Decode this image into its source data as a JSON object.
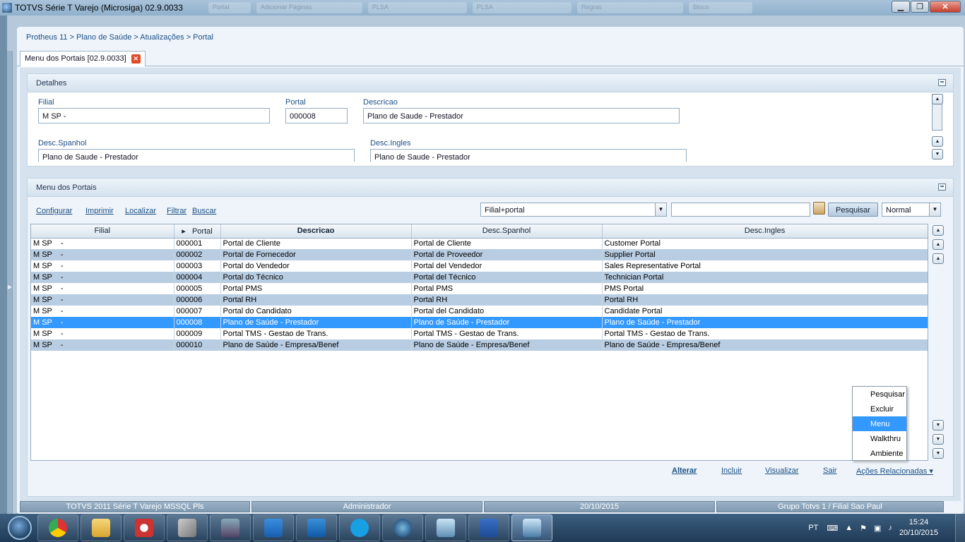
{
  "window": {
    "title": "TOTVS Série T Varejo (Microsiga) 02.9.0033",
    "ghost_tabs": [
      "Portal",
      "Adicionar Páginas",
      "PLSA",
      "PLSA",
      "Regras",
      "Bloco"
    ],
    "controls": {
      "minimize": "▁",
      "maximize": "❐",
      "close": "✕"
    }
  },
  "breadcrumb": "Protheus 11 > Plano de Saúde > Atualizações > Portal",
  "tab": {
    "label": "Menu dos Portais [02.9.0033]",
    "close": "✕"
  },
  "details": {
    "title": "Detalhes",
    "fields": {
      "filial": {
        "label": "Filial",
        "value": "M SP    -"
      },
      "portal": {
        "label": "Portal",
        "value": "000008"
      },
      "descricao": {
        "label": "Descricao",
        "value": "Plano de Saude - Prestador"
      },
      "desc_spanhol": {
        "label": "Desc.Spanhol",
        "value": "Plano de Saude - Prestador"
      },
      "desc_ingles": {
        "label": "Desc.Ingles",
        "value": "Plano de Saude - Prestador"
      }
    }
  },
  "menu_panel": {
    "title": "Menu dos Portais",
    "toolbar_links": [
      "Configurar",
      "Imprimir",
      "Localizar",
      "Filtrar",
      "Buscar"
    ],
    "index_combo": "Filial+portal",
    "search_value": "",
    "search_button": "Pesquisar",
    "mode_combo": "Normal"
  },
  "grid": {
    "columns": [
      "Filial",
      "Portal",
      "Descricao",
      "Desc.Spanhol",
      "Desc.Ingles"
    ],
    "sort_indicator": "▸",
    "rows": [
      [
        "M SP    -",
        "000001",
        "Portal de Cliente",
        "Portal de Cliente",
        "Customer Portal"
      ],
      [
        "M SP    -",
        "000002",
        "Portal de Fornecedor",
        "Portal de Proveedor",
        "Supplier Portal"
      ],
      [
        "M SP    -",
        "000003",
        "Portal do Vendedor",
        "Portal del Vendedor",
        "Sales Representative Portal"
      ],
      [
        "M SP    -",
        "000004",
        "Portal do Técnico",
        "Portal del Técnico",
        "Technician Portal"
      ],
      [
        "M SP    -",
        "000005",
        "Portal PMS",
        "Portal PMS",
        "PMS Portal"
      ],
      [
        "M SP    -",
        "000006",
        "Portal RH",
        "Portal RH",
        "Portal RH"
      ],
      [
        "M SP    -",
        "000007",
        "Portal do Candidato",
        "Portal del Candidato",
        "Candidate Portal"
      ],
      [
        "M SP    -",
        "000008",
        "Plano de Saúde - Prestador",
        "Plano de Saúde - Prestador",
        "Plano de Saúde - Prestador"
      ],
      [
        "M SP    -",
        "000009",
        "Portal TMS - Gestao de Trans.",
        "Portal TMS - Gestao de Trans.",
        "Portal TMS - Gestao de Trans."
      ],
      [
        "M SP    -",
        "000010",
        "Plano de Saúde - Empresa/Benef",
        "Plano de Saúde - Empresa/Benef",
        "Plano de Saúde - Empresa/Benef"
      ]
    ],
    "selected_index": 7
  },
  "context_menu": {
    "items": [
      "Pesquisar",
      "Excluir",
      "Menu",
      "Walkthru",
      "Ambiente"
    ],
    "active_index": 2
  },
  "actions": {
    "alterar": "Alterar",
    "incluir": "Incluir",
    "visualizar": "Visualizar",
    "sair": "Sair",
    "acoes": "Ações Relacionadas ▾"
  },
  "status": {
    "system": "TOTVS 2011 Série T Varejo MSSQL Pls",
    "user": "Administrador",
    "date": "20/10/2015",
    "company": "Grupo Totvs 1 / Filial Sao Paul"
  },
  "taskbar": {
    "apps": [
      "chrome-icon",
      "file-explorer-icon",
      "snipping-tool-icon",
      "tools-icon",
      "infinity-icon",
      "lync-icon",
      "outlook-icon",
      "skype-icon",
      "dev-studio-icon",
      "remote-desktop-icon",
      "word-icon",
      "protheus-icon"
    ],
    "lang": "PT",
    "time": "15:24",
    "date": "20/10/2015"
  },
  "colors": {
    "selection": "#3399ff",
    "alt_row": "#b8cde2",
    "link": "#1c4f86",
    "close_red": "#e04b2a"
  }
}
